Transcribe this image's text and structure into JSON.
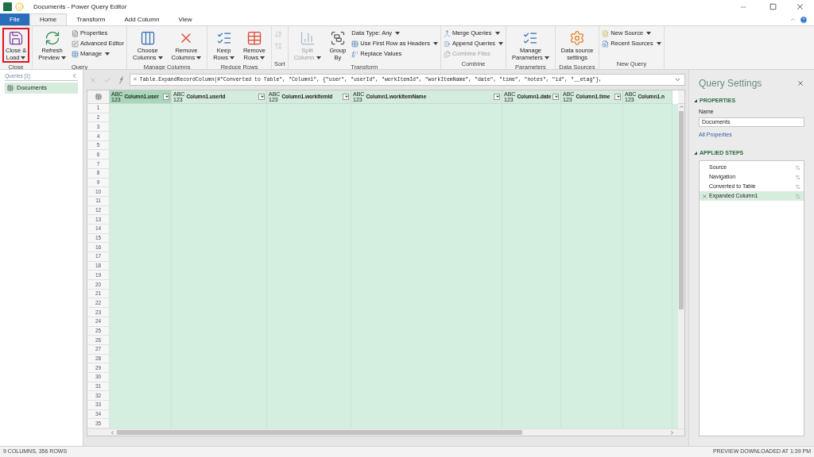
{
  "window": {
    "title": "Documents - Power Query Editor"
  },
  "tabs": [
    {
      "label": "File",
      "kind": "file",
      "selected": false
    },
    {
      "label": "Home",
      "kind": "tab",
      "selected": true
    },
    {
      "label": "Transform",
      "kind": "tab",
      "selected": false
    },
    {
      "label": "Add Column",
      "kind": "tab",
      "selected": false
    },
    {
      "label": "View",
      "kind": "tab",
      "selected": false
    }
  ],
  "ribbon": [
    {
      "label": "Close",
      "buttons": [
        {
          "kind": "large",
          "lines": [
            "Close &",
            "Load"
          ],
          "dropdown": true,
          "highlighted": true
        }
      ]
    },
    {
      "label": "Query",
      "buttons": [
        {
          "kind": "large",
          "lines": [
            "Refresh",
            "Preview"
          ],
          "dropdown": true
        },
        {
          "kind": "small",
          "lines": [
            "Properties"
          ]
        },
        {
          "kind": "small",
          "lines": [
            "Advanced Editor"
          ]
        },
        {
          "kind": "small",
          "lines": [
            "Manage"
          ],
          "dropdown": true
        }
      ]
    },
    {
      "label": "Manage Columns",
      "buttons": [
        {
          "kind": "large",
          "lines": [
            "Choose",
            "Columns"
          ],
          "dropdown": true
        },
        {
          "kind": "large",
          "lines": [
            "Remove",
            "Columns"
          ],
          "dropdown": true
        }
      ]
    },
    {
      "label": "Reduce Rows",
      "buttons": [
        {
          "kind": "large",
          "lines": [
            "Keep",
            "Rows"
          ],
          "dropdown": true
        },
        {
          "kind": "large",
          "lines": [
            "Remove",
            "Rows"
          ],
          "dropdown": true
        }
      ]
    },
    {
      "label": "Sort",
      "buttons": [
        {
          "kind": "icon",
          "disabled": true
        },
        {
          "kind": "icon",
          "disabled": true
        }
      ]
    },
    {
      "label": "Transform",
      "buttons": [
        {
          "kind": "large",
          "lines": [
            "Split",
            "Column"
          ],
          "dropdown": true,
          "disabled": true
        },
        {
          "kind": "large",
          "lines": [
            "Group",
            "By"
          ]
        },
        {
          "kind": "small",
          "lines": [
            "Data Type: Any"
          ],
          "dropdown": true
        },
        {
          "kind": "small",
          "lines": [
            "Use First Row as Headers"
          ],
          "dropdown": true
        },
        {
          "kind": "small",
          "lines": [
            "Replace Values"
          ]
        }
      ]
    },
    {
      "label": "Combine",
      "buttons": [
        {
          "kind": "small",
          "lines": [
            "Merge Queries"
          ],
          "dropdown": true
        },
        {
          "kind": "small",
          "lines": [
            "Append Queries"
          ],
          "dropdown": true
        },
        {
          "kind": "small",
          "lines": [
            "Combine Files"
          ],
          "disabled": true
        }
      ]
    },
    {
      "label": "Parameters",
      "buttons": [
        {
          "kind": "large",
          "lines": [
            "Manage",
            "Parameters"
          ],
          "dropdown": true
        }
      ]
    },
    {
      "label": "Data Sources",
      "buttons": [
        {
          "kind": "large",
          "lines": [
            "Data source",
            "settings"
          ]
        }
      ]
    },
    {
      "label": "New Query",
      "buttons": [
        {
          "kind": "small",
          "lines": [
            "New Source"
          ],
          "dropdown": true
        },
        {
          "kind": "small",
          "lines": [
            "Recent Sources"
          ],
          "dropdown": true
        }
      ]
    }
  ],
  "queries": {
    "title": "Queries [1]",
    "items": [
      {
        "label": "Documents",
        "selected": true
      }
    ]
  },
  "formula": "= Table.ExpandRecordColumn(#\"Converted to Table\", \"Column1\", {\"user\", \"userId\", \"workItemId\", \"workItemName\", \"date\", \"time\", \"notes\", \"id\", \"__etag\"},",
  "table": {
    "columns": [
      {
        "name": "Column1.user",
        "type": [
          "ABC",
          "123"
        ],
        "selected": true
      },
      {
        "name": "Column1.userId",
        "type": [
          "ABC",
          "123"
        ],
        "selected": false
      },
      {
        "name": "Column1.workItemId",
        "type": [
          "ABC",
          "123"
        ],
        "selected": false
      },
      {
        "name": "Column1.workItemName",
        "type": [
          "ABC",
          "123"
        ],
        "selected": false
      },
      {
        "name": "Column1.date",
        "type": [
          "ABC",
          "123"
        ],
        "selected": false
      },
      {
        "name": "Column1.time",
        "type": [
          "ABC",
          "123"
        ],
        "selected": false
      },
      {
        "name": "Column1.n",
        "type": [
          "ABC",
          "123"
        ],
        "selected": false
      }
    ],
    "row_numbers": [
      "1",
      "2",
      "3",
      "4",
      "5",
      "6",
      "7",
      "8",
      "9",
      "10",
      "11",
      "12",
      "13",
      "14",
      "15",
      "16",
      "17",
      "18",
      "19",
      "20",
      "21",
      "22",
      "23",
      "24",
      "25",
      "26",
      "27",
      "28",
      "29",
      "30",
      "31",
      "32",
      "33",
      "34",
      "35"
    ]
  },
  "query_settings": {
    "title": "Query Settings",
    "properties_heading": "PROPERTIES",
    "name_label": "Name",
    "name_value": "Documents",
    "all_properties": "All Properties",
    "steps_heading": "APPLIED STEPS",
    "steps": [
      {
        "label": "Source",
        "selected": false
      },
      {
        "label": "Navigation",
        "selected": false
      },
      {
        "label": "Converted to Table",
        "selected": false
      },
      {
        "label": "Expanded Column1",
        "selected": true
      }
    ]
  },
  "status_bar": {
    "left": "9 COLUMNS, 356 ROWS",
    "right": "PREVIEW DOWNLOADED AT 1:39 PM"
  }
}
